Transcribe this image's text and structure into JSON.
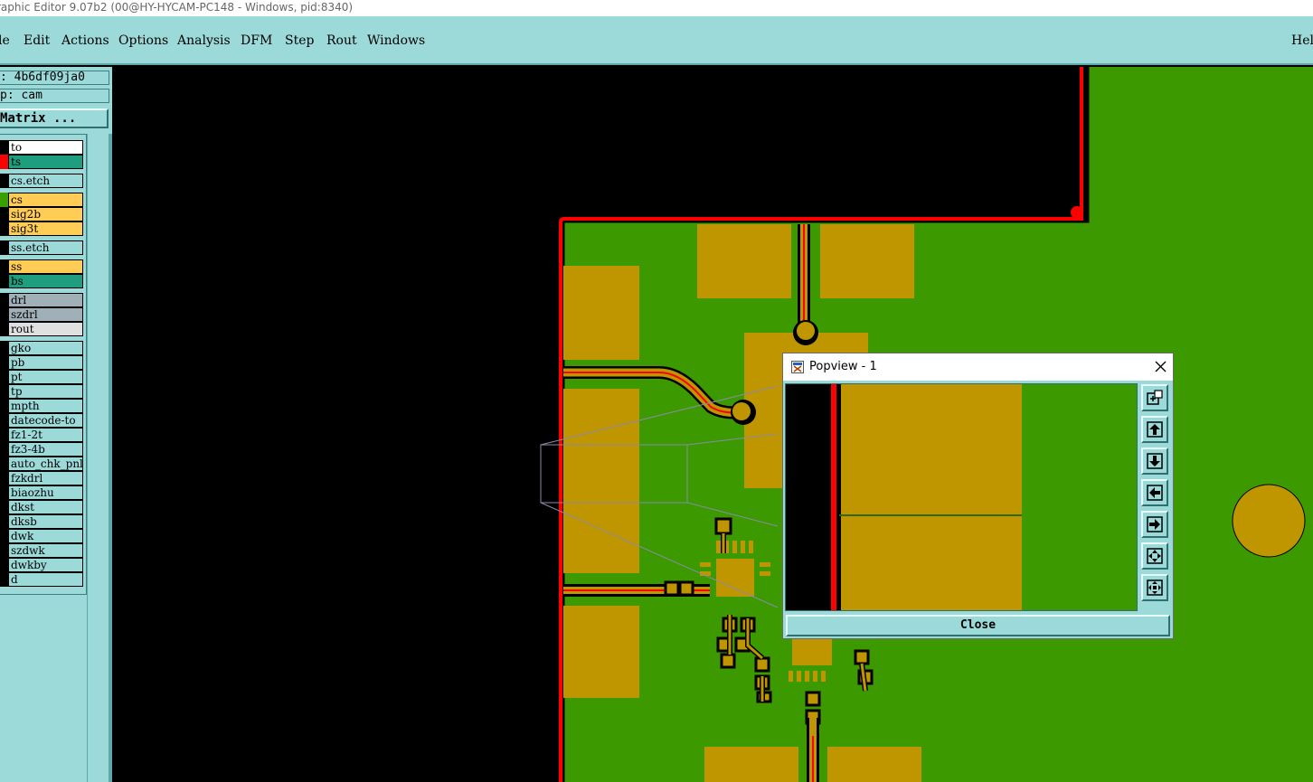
{
  "window": {
    "title": "raphic Editor 9.07b2 (00@HY-HYCAM-PC148 - Windows, pid:8340)"
  },
  "menubar": {
    "items": [
      {
        "label": "le"
      },
      {
        "label": "Edit"
      },
      {
        "label": "Actions"
      },
      {
        "label": "Options"
      },
      {
        "label": "Analysis"
      },
      {
        "label": "DFM"
      },
      {
        "label": "Step"
      },
      {
        "label": "Rout"
      },
      {
        "label": "Windows"
      }
    ],
    "help_label": "Hel"
  },
  "job": {
    "job_label": " : 4b6df09ja0",
    "step_label": "p: cam",
    "matrix_button": " Matrix ..."
  },
  "layers": [
    {
      "name": "to",
      "color": "#000000",
      "bg": "#ffffff"
    },
    {
      "name": "ts",
      "color": "#ff0000",
      "bg": "#1e9e7e"
    },
    {
      "name": "cs.etch",
      "color": "#000000",
      "bg": "#9cd9d9"
    },
    {
      "name": "cs",
      "color": "#3aa000",
      "bg": "#ffcc55"
    },
    {
      "name": "sig2b",
      "color": "#000000",
      "bg": "#ffcc55"
    },
    {
      "name": "sig3t",
      "color": "#000000",
      "bg": "#ffcc55"
    },
    {
      "name": "ss.etch",
      "color": "#000000",
      "bg": "#9cd9d9"
    },
    {
      "name": "ss",
      "color": "#000000",
      "bg": "#ffcc55"
    },
    {
      "name": "bs",
      "color": "#000000",
      "bg": "#1e9e7e"
    },
    {
      "name": "drl",
      "color": "#000000",
      "bg": "#a0b0b8"
    },
    {
      "name": "szdrl",
      "color": "#000000",
      "bg": "#a0b0b8"
    },
    {
      "name": "rout",
      "color": "#000000",
      "bg": "#e0e0e0"
    },
    {
      "name": "gko",
      "color": "#000000",
      "bg": "#9cd9d9"
    },
    {
      "name": "pb",
      "color": "#000000",
      "bg": "#9cd9d9"
    },
    {
      "name": "pt",
      "color": "#000000",
      "bg": "#9cd9d9"
    },
    {
      "name": "tp",
      "color": "#000000",
      "bg": "#9cd9d9"
    },
    {
      "name": "mpth",
      "color": "#000000",
      "bg": "#9cd9d9"
    },
    {
      "name": "datecode-to",
      "color": "#000000",
      "bg": "#9cd9d9"
    },
    {
      "name": "fz1-2t",
      "color": "#000000",
      "bg": "#9cd9d9"
    },
    {
      "name": "fz3-4b",
      "color": "#000000",
      "bg": "#9cd9d9"
    },
    {
      "name": "auto_chk_pnl",
      "color": "#000000",
      "bg": "#9cd9d9"
    },
    {
      "name": "fzkdrl",
      "color": "#000000",
      "bg": "#9cd9d9"
    },
    {
      "name": "biaozhu",
      "color": "#000000",
      "bg": "#9cd9d9"
    },
    {
      "name": "dkst",
      "color": "#000000",
      "bg": "#9cd9d9"
    },
    {
      "name": "dksb",
      "color": "#000000",
      "bg": "#9cd9d9"
    },
    {
      "name": "dwk",
      "color": "#000000",
      "bg": "#9cd9d9"
    },
    {
      "name": "szdwk",
      "color": "#000000",
      "bg": "#9cd9d9"
    },
    {
      "name": "dwkby",
      "color": "#000000",
      "bg": "#9cd9d9"
    },
    {
      "name": "d",
      "color": "#000000",
      "bg": "#9cd9d9"
    }
  ],
  "popview": {
    "title": "Popview - 1",
    "close_label": "Close",
    "tools": [
      {
        "icon": "zoom-window-icon"
      },
      {
        "icon": "pan-up-icon"
      },
      {
        "icon": "pan-down-icon"
      },
      {
        "icon": "pan-left-icon"
      },
      {
        "icon": "pan-right-icon"
      },
      {
        "icon": "zoom-fit-icon"
      },
      {
        "icon": "zoom-home-icon"
      }
    ]
  },
  "colors": {
    "panel": "#9cd9d9",
    "board": "#3c9a00",
    "pad": "#bf9600",
    "trace": "#ff0000",
    "background": "#000000"
  }
}
